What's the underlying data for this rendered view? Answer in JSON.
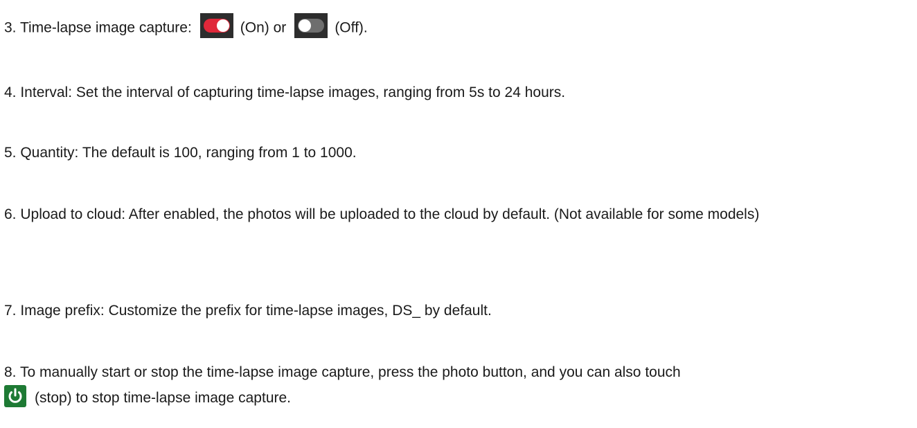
{
  "items": {
    "item3": {
      "text_before": "3. Time-lapse image capture:",
      "on_label": "(On) or",
      "off_label": "(Off).",
      "toggle_on_icon": "toggle-on-icon",
      "toggle_off_icon": "toggle-off-icon"
    },
    "item4": {
      "text": "4. Interval: Set the interval of capturing time-lapse images, ranging from 5s to 24 hours."
    },
    "item5": {
      "text": "5. Quantity: The default is 100, ranging from 1 to 1000."
    },
    "item6": {
      "text": "6. Upload to cloud: After enabled, the photos will be uploaded to the cloud by default. (Not available for some models)"
    },
    "item7": {
      "text": "7. Image prefix: Customize the prefix for time-lapse images, DS_ by default."
    },
    "item8": {
      "text_line1": "8. To manually start or stop the time-lapse image capture, press the photo button, and you can also touch",
      "stop_icon": "power-icon",
      "text_line2": "(stop) to stop time-lapse image capture."
    }
  },
  "colors": {
    "toggle_on": "#e0283a",
    "toggle_off": "#6e6e6e",
    "toggle_bg": "#2d2d2d",
    "power_bg": "#1e7a34"
  }
}
